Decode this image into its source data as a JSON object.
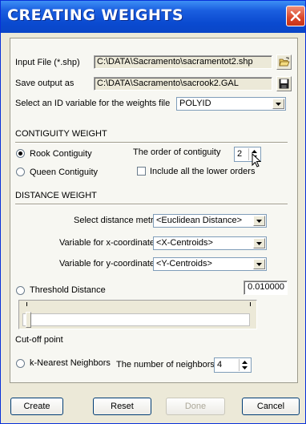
{
  "window": {
    "title": "CREATING WEIGHTS"
  },
  "input_file": {
    "label": "Input File (*.shp)",
    "value": "C:\\DATA\\Sacramento\\sacramentot2.shp"
  },
  "save_output": {
    "label": "Save output as",
    "value": "C:\\DATA\\Sacramento\\sacrook2.GAL"
  },
  "id_variable": {
    "label": "Select an ID variable for the weights file",
    "value": "POLYID"
  },
  "contiguity": {
    "heading": "CONTIGUITY WEIGHT",
    "rook_label": "Rook Contiguity",
    "queen_label": "Queen Contiguity",
    "selected": "rook",
    "order_label": "The order of contiguity",
    "order_value": "2",
    "include_lower_label": "Include all the lower orders",
    "include_lower_checked": false
  },
  "distance": {
    "heading": "DISTANCE WEIGHT",
    "metric_label": "Select distance metric",
    "metric_value": "<Euclidean Distance>",
    "x_label": "Variable for x-coordinates",
    "x_value": "<X-Centroids>",
    "y_label": "Variable for y-coordinates",
    "y_value": "<Y-Centroids>",
    "threshold_label": "Threshold Distance",
    "threshold_value": "0.010000",
    "cutoff_label": "Cut-off point",
    "knn_label": "k-Nearest Neighbors",
    "neighbors_label": "The number of neighbors",
    "neighbors_value": "4"
  },
  "buttons": {
    "create": "Create",
    "reset": "Reset",
    "done": "Done",
    "cancel": "Cancel"
  },
  "icons": {
    "browse": "folder-open-icon",
    "save": "floppy-disk-icon",
    "close": "close-icon"
  }
}
